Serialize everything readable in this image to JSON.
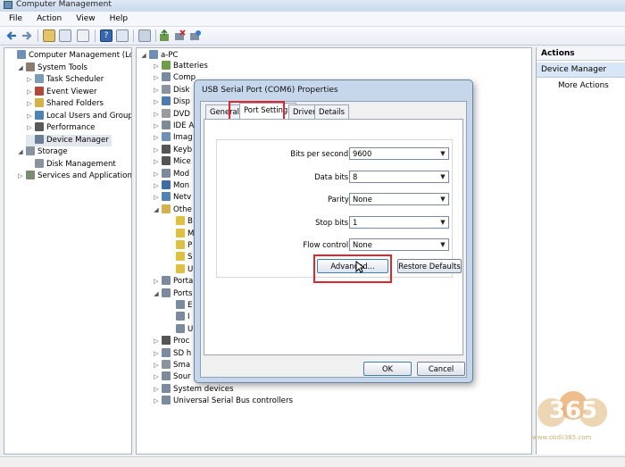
{
  "window": {
    "title": "Computer Management"
  },
  "menu": [
    "File",
    "Action",
    "View",
    "Help"
  ],
  "left_tree": [
    {
      "label": "Computer Management (Local",
      "expander": "",
      "icon": "#6f8fb6"
    },
    {
      "label": "System Tools",
      "expander": "◢",
      "icon": "#8a7d6d"
    },
    {
      "label": "Task Scheduler",
      "expander": "▷",
      "icon": "#7d9ab8"
    },
    {
      "label": "Event Viewer",
      "expander": "▷",
      "icon": "#b04a3a"
    },
    {
      "label": "Shared Folders",
      "expander": "▷",
      "icon": "#d6b14a"
    },
    {
      "label": "Local Users and Groups",
      "expander": "▷",
      "icon": "#4f82b5"
    },
    {
      "label": "Performance",
      "expander": "▷",
      "icon": "#5a5a5a"
    },
    {
      "label": "Device Manager",
      "expander": "",
      "icon": "#6a7f96"
    },
    {
      "label": "Storage",
      "expander": "◢",
      "icon": "#8a93a0"
    },
    {
      "label": "Disk Management",
      "expander": "",
      "icon": "#8a93a0"
    },
    {
      "label": "Services and Applications",
      "expander": "▷",
      "icon": "#7c8a72"
    }
  ],
  "device_tree": {
    "root": "a-PC",
    "items": [
      {
        "label": "Batteries",
        "expander": "▷"
      },
      {
        "label": "Comp",
        "expander": "▷"
      },
      {
        "label": "Disk",
        "expander": "▷"
      },
      {
        "label": "Disp",
        "expander": "▷"
      },
      {
        "label": "DVD",
        "expander": "▷"
      },
      {
        "label": "IDE A",
        "expander": "▷"
      },
      {
        "label": "Imag",
        "expander": "▷"
      },
      {
        "label": "Keyb",
        "expander": "▷"
      },
      {
        "label": "Mice",
        "expander": "▷"
      },
      {
        "label": "Mod",
        "expander": "▷"
      },
      {
        "label": "Mon",
        "expander": "▷"
      },
      {
        "label": "Netv",
        "expander": "▷"
      },
      {
        "label": "Othe",
        "expander": "◢"
      },
      {
        "label": "B",
        "expander": ""
      },
      {
        "label": "M",
        "expander": ""
      },
      {
        "label": "P",
        "expander": ""
      },
      {
        "label": "S",
        "expander": ""
      },
      {
        "label": "U",
        "expander": ""
      },
      {
        "label": "Porta",
        "expander": "▷"
      },
      {
        "label": "Ports",
        "expander": "◢"
      },
      {
        "label": "E",
        "expander": ""
      },
      {
        "label": "I",
        "expander": ""
      },
      {
        "label": "U",
        "expander": ""
      },
      {
        "label": "Proc",
        "expander": "▷"
      },
      {
        "label": "SD h",
        "expander": "▷"
      },
      {
        "label": "Sma",
        "expander": "▷"
      },
      {
        "label": "Sour",
        "expander": "▷"
      },
      {
        "label": "System devices",
        "expander": "▷"
      },
      {
        "label": "Universal Serial Bus controllers",
        "expander": "▷"
      }
    ]
  },
  "dialog": {
    "title": "USB Serial Port (COM6) Properties",
    "tabs": [
      "General",
      "Port Settings",
      "Driver",
      "Details"
    ],
    "active_tab": "Port Settings",
    "fields": [
      {
        "label": "Bits per second:",
        "value": "9600"
      },
      {
        "label": "Data bits:",
        "value": "8"
      },
      {
        "label": "Parity:",
        "value": "None"
      },
      {
        "label": "Stop bits:",
        "value": "1"
      },
      {
        "label": "Flow control:",
        "value": "None"
      }
    ],
    "advanced_label": "Advanced...",
    "restore_label": "Restore Defaults",
    "ok_label": "OK",
    "cancel_label": "Cancel"
  },
  "actions_pane": {
    "header": "Actions",
    "section": "Device Manager",
    "more": "More Actions"
  },
  "watermark": {
    "logo": "365",
    "url": "www.obdii365.com"
  },
  "colors": {
    "highlight_box": "#e0262c",
    "selection": "#d9e6f5"
  }
}
